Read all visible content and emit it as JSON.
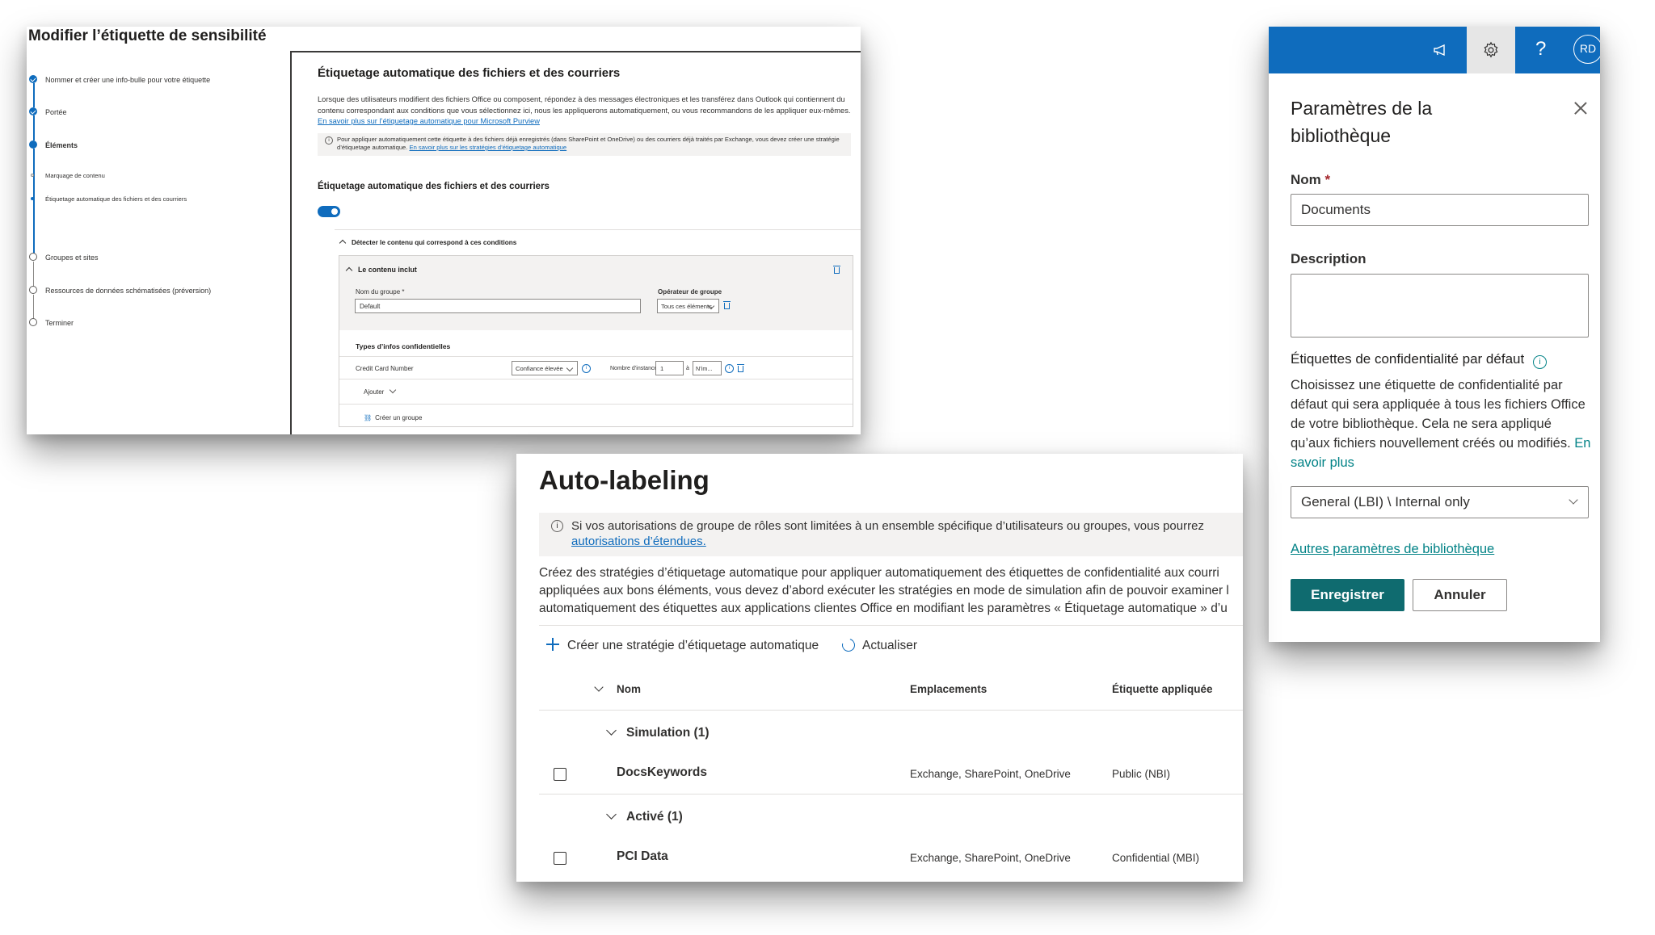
{
  "label_editor": {
    "title": "Modifier l’étiquette de sensibilité",
    "steps": [
      {
        "label": "Nommer et créer une info-bulle pour votre étiquette",
        "state": "done"
      },
      {
        "label": "Portée",
        "state": "done"
      },
      {
        "label": "Éléments",
        "state": "current"
      },
      {
        "label": "Marquage de contenu",
        "state": "sub"
      },
      {
        "label": "Étiquetage automatique des fichiers et des courriers",
        "state": "sub-current"
      },
      {
        "label": "Groupes et sites",
        "state": "todo"
      },
      {
        "label": "Ressources de données schématisées (préversion)",
        "state": "todo"
      },
      {
        "label": "Terminer",
        "state": "todo"
      }
    ],
    "heading": "Étiquetage automatique des fichiers et des courriers",
    "description": "Lorsque des utilisateurs modifient des fichiers Office ou composent, répondez à des messages électroniques et les transférez dans Outlook qui contiennent du contenu correspondant aux conditions que vous sélectionnez ici, nous les appliquerons automatiquement, ou vous recommandons de les appliquer eux-mêmes.",
    "description_link": "En savoir plus sur l’étiquetage automatique pour Microsoft Purview",
    "note": "Pour appliquer automatiquement cette étiquette à des fichiers déjà enregistrés (dans SharePoint et OneDrive) ou des courriers déjà traités par Exchange, vous devez créer une stratégie d’étiquetage automatique.",
    "note_link": "En savoir plus sur les stratégies d’étiquetage automatique",
    "toggle_heading": "Étiquetage automatique des fichiers et des courriers",
    "toggle_on": true,
    "detect_label": "Détecter le contenu qui correspond à ces conditions",
    "group_header": "Le contenu inclut",
    "group_name_label": "Nom du groupe *",
    "group_name_value": "Default",
    "operator_label": "Opérateur de groupe",
    "operator_value": "Tous ces éléments",
    "info_types_label": "Types d’infos confidentielles",
    "info_type_name": "Credit Card Number",
    "confidence_value": "Confiance élevée",
    "instances_label": "Nombre d’instances",
    "instances_min": "1",
    "instances_to": "à",
    "instances_max": "N’im...",
    "add_label": "Ajouter",
    "create_group_label": "Créer un groupe"
  },
  "library_settings": {
    "title": "Paramètres de la bibliothèque",
    "avatar_initials": "RD",
    "help_glyph": "?",
    "name_label": "Nom",
    "required_mark": "*",
    "name_value": "Documents",
    "description_label": "Description",
    "default_labels_heading": "Étiquettes de confidentialité par défaut",
    "default_labels_text": "Choisissez une étiquette de confidentialité par défaut qui sera appliquée à tous les fichiers Office de votre bibliothèque. Cela ne sera appliqué qu’aux fichiers nouvellement créés ou modifiés.",
    "learn_more": "En savoir plus",
    "default_label_value": "General (LBI) \\ Internal only",
    "more_settings_link": "Autres paramètres de bibliothèque",
    "save_button": "Enregistrer",
    "cancel_button": "Annuler",
    "icons": [
      "megaphone-icon",
      "gear-icon",
      "help-icon",
      "close-icon",
      "info-icon",
      "chevron-down-icon"
    ]
  },
  "auto_labeling": {
    "title": "Auto-labeling",
    "message": "Si vos autorisations de groupe de rôles sont limitées à un ensemble spécifique d’utilisateurs ou groupes, vous pourrez",
    "message_link": "autorisations d’étendues.",
    "description_lines": [
      "Créez des stratégies d’étiquetage automatique pour appliquer automatiquement des étiquettes de confidentialité aux courri",
      "appliquées aux bons éléments, vous devez d’abord exécuter les stratégies en mode de simulation afin de pouvoir examiner l",
      "automatiquement des étiquettes aux applications clientes Office en modifiant les paramètres « Étiquetage automatique » d’u"
    ],
    "create_policy": "Créer une stratégie d’étiquetage automatique",
    "refresh": "Actualiser",
    "columns": [
      "Nom",
      "Emplacements",
      "Étiquette appliquée"
    ],
    "groups": [
      {
        "label": "Simulation (1)",
        "rows": [
          {
            "name": "DocsKeywords",
            "locations": "Exchange, SharePoint, OneDrive",
            "label": "Public (NBI)"
          }
        ]
      },
      {
        "label": "Activé (1)",
        "rows": [
          {
            "name": "PCI Data",
            "locations": "Exchange, SharePoint, OneDrive",
            "label": "Confidential (MBI)"
          }
        ]
      }
    ]
  }
}
